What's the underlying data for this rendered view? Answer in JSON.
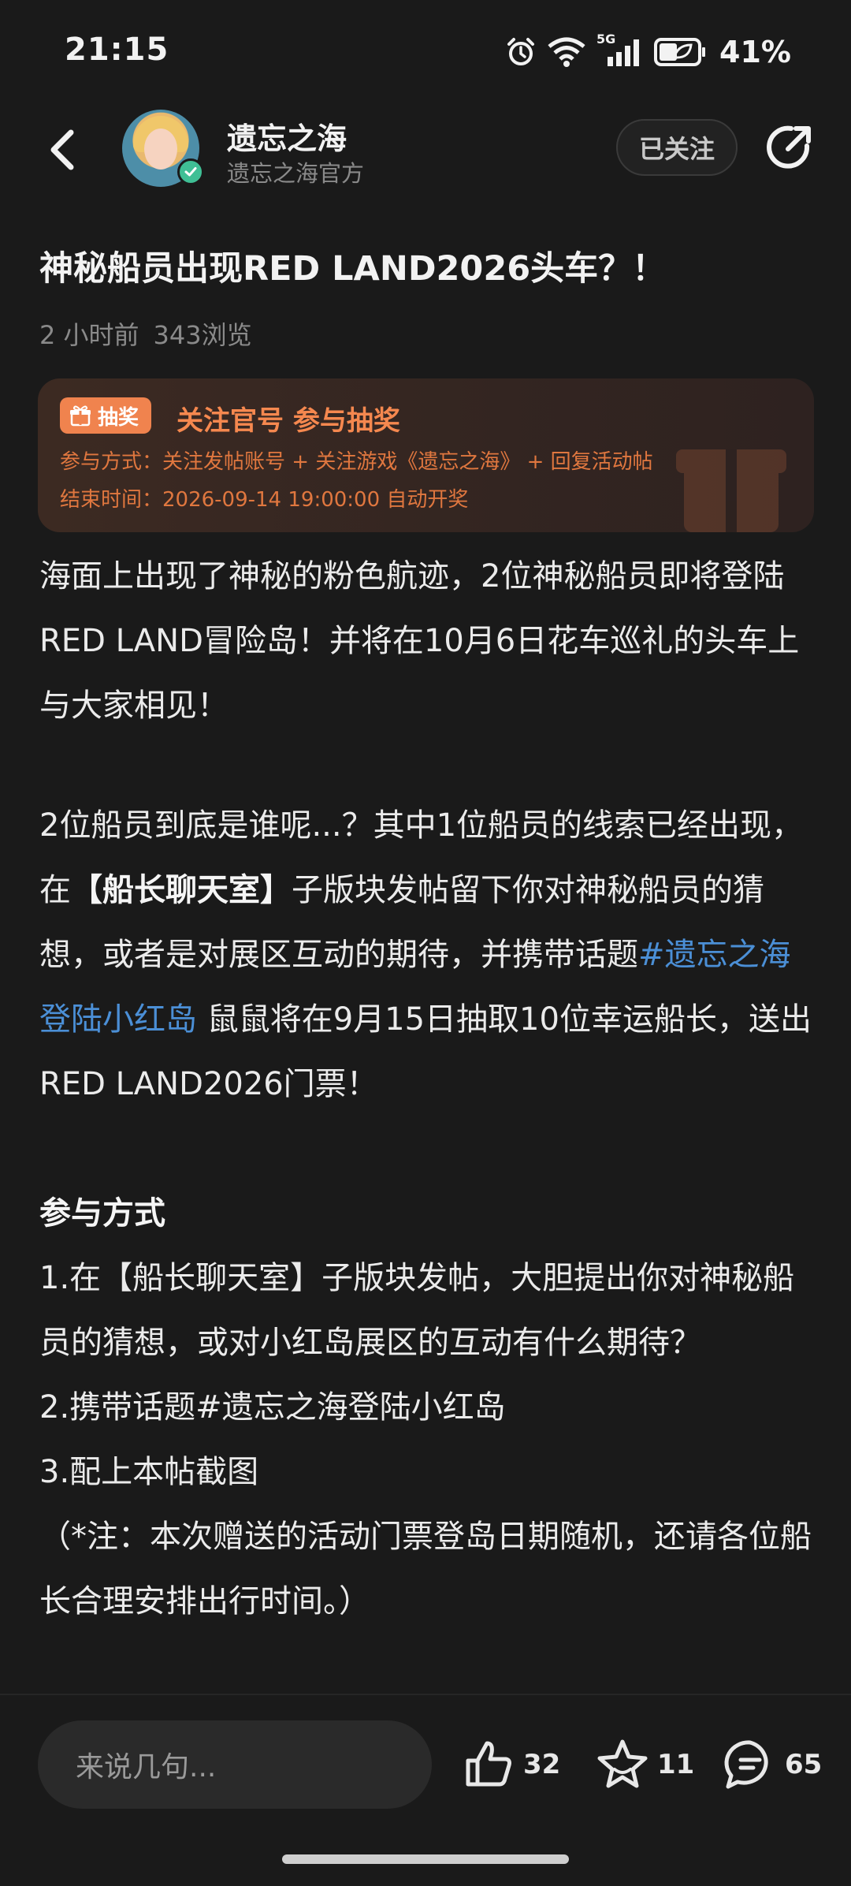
{
  "status_bar": {
    "time": "21:15",
    "network_label": "5G",
    "battery_percent": "41%"
  },
  "header": {
    "account_name": "遗忘之海",
    "account_subtitle": "遗忘之海官方",
    "follow_label": "已关注",
    "back_icon": "back-arrow-icon",
    "share_icon": "share-icon"
  },
  "post": {
    "title": "神秘船员出现RED LAND2026头车？！",
    "time_ago": "2 小时前",
    "views": "343浏览"
  },
  "lottery": {
    "badge_label": "抽奖",
    "heading": "关注官号 参与抽奖",
    "method_line": "参与方式：关注发帖账号 + 关注游戏《遗忘之海》 + 回复活动帖",
    "end_line": "结束时间：2026-09-14 19:00:00 自动开奖"
  },
  "body": {
    "p1": "海面上出现了神秘的粉色航迹，2位神秘船员即将登陆RED LAND冒险岛！并将在10月6日花车巡礼的头车上与大家相见！",
    "p2_a": "2位船员到底是谁呢...？其中1位船员的线索已经出现，在",
    "p2_bold": "【船长聊天室】",
    "p2_b": "子版块发帖留下你对神秘船员的猜想，或者是对展区互动的期待，并携带话题",
    "p2_hashtag": "#遗忘之海登陆小红岛",
    "p2_c": " 鼠鼠将在9月15日抽取10位幸运船长，送出RED LAND2026门票！",
    "section_heading": "参与方式",
    "step1": "1.在【船长聊天室】子版块发帖，大胆提出你对神秘船员的猜想，或对小红岛展区的互动有什么期待？",
    "step2": "2.携带话题#遗忘之海登陆小红岛",
    "step3": "3.配上本帖截图",
    "note": "（*注：本次赠送的活动门票登岛日期随机，还请各位船长合理安排出行时间。）"
  },
  "bottom_bar": {
    "comment_placeholder": "来说几句...",
    "likes": "32",
    "favorites": "11",
    "comments": "65"
  }
}
